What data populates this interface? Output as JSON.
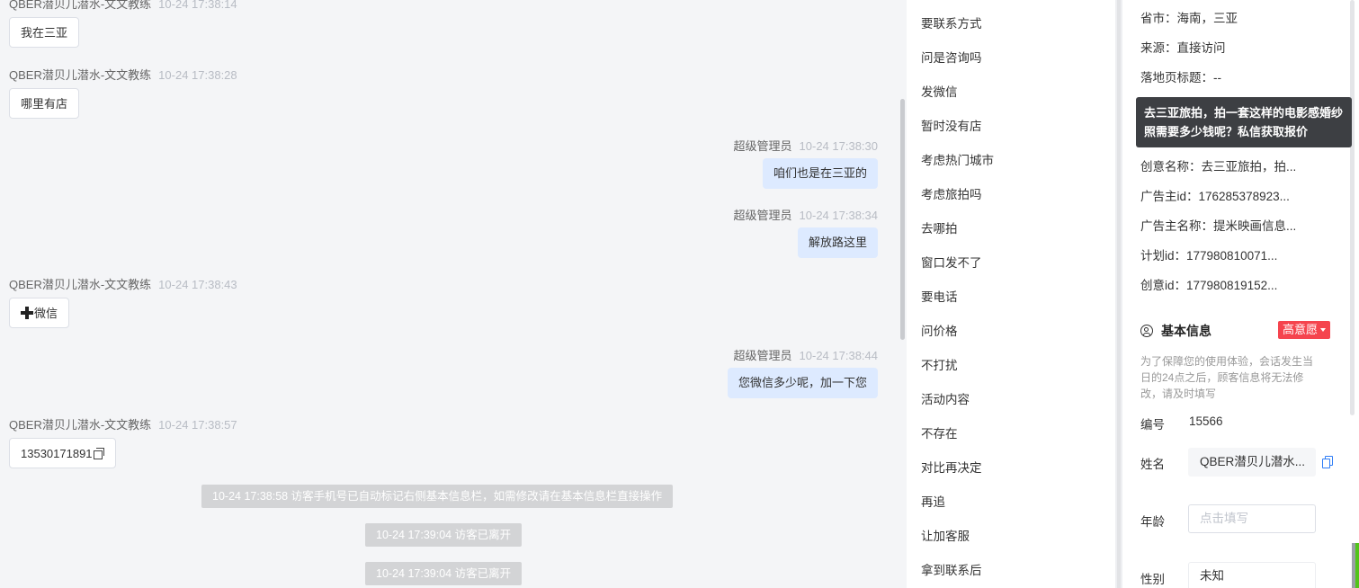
{
  "chat": {
    "messages": [
      {
        "sender": "QBER潜贝儿潜水-文文教练",
        "time": "10-24 17:38:14",
        "text": "我在三亚"
      },
      {
        "sender": "QBER潜贝儿潜水-文文教练",
        "time": "10-24 17:38:28",
        "text": "哪里有店"
      },
      {
        "sender": "超级管理员",
        "time": "10-24 17:38:30",
        "text": "咱们也是在三亚的"
      },
      {
        "sender": "超级管理员",
        "time": "10-24 17:38:34",
        "text": "解放路这里"
      },
      {
        "sender": "QBER潜贝儿潜水-文文教练",
        "time": "10-24 17:38:43",
        "text": "微信"
      },
      {
        "sender": "超级管理员",
        "time": "10-24 17:38:44",
        "text": "您微信多少呢，加一下您"
      },
      {
        "sender": "QBER潜贝儿潜水-文文教练",
        "time": "10-24 17:38:57",
        "text": "13530171891"
      }
    ],
    "system": [
      "10-24 17:38:58 访客手机号已自动标记右侧基本信息栏，如需修改请在基本信息栏直接操作",
      "10-24 17:39:04 访客已离开",
      "10-24 17:39:04 访客已离开"
    ]
  },
  "quick_replies": [
    "要联系方式",
    "问是咨询吗",
    "发微信",
    "暂时没有店",
    "考虑热门城市",
    "考虑旅拍吗",
    "去哪拍",
    "窗口发不了",
    "要电话",
    "问价格",
    "不打扰",
    "活动内容",
    "不存在",
    "对比再决定",
    "再追",
    "让加客服",
    "拿到联系后"
  ],
  "source_info": [
    "省市：海南，三亚",
    "来源：直接访问",
    "落地页标题：--",
    "创意名称：去三亚旅拍，拍...",
    "广告主id：176285378923...",
    "广告主名称：提米映画信息...",
    "计划id：177980810071...",
    "创意id：177980819152..."
  ],
  "tooltip": "去三亚旅拍，拍一套这样的电影感婚纱照需要多少钱呢？私信获取报价",
  "basic_info": {
    "title": "基本信息",
    "intent": "高意愿",
    "notice": "为了保障您的使用体验，会话发生当日的24点之后，顾客信息将无法修改，请及时填写",
    "id_label": "编号",
    "id_value": "15566",
    "name_label": "姓名",
    "name_value": "QBER潜贝儿潜水...",
    "age_label": "年龄",
    "age_placeholder": "点击填写",
    "gender_label": "性别",
    "gender_value": "未知"
  }
}
